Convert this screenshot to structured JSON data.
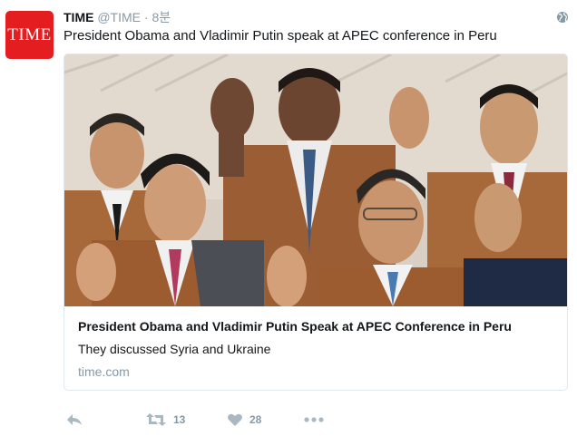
{
  "tweet": {
    "avatar_text": "TIME",
    "author_name": "TIME",
    "handle": "@TIME",
    "separator": "·",
    "timestamp": "8분",
    "text": "President Obama and Vladimir Putin speak at APEC conference in Peru",
    "audience_icon": "globe-icon"
  },
  "card": {
    "image_icon": "photo",
    "title": "President Obama and Vladimir Putin Speak at APEC Conference in Peru",
    "description": "They discussed Syria and Ukraine",
    "domain": "time.com"
  },
  "actions": {
    "reply_icon": "reply-icon",
    "retweet_icon": "retweet-icon",
    "retweet_count": "13",
    "like_icon": "heart-icon",
    "like_count": "28",
    "more_icon": "more-icon"
  },
  "colors": {
    "brand": "#e41d21",
    "muted": "#8899a6",
    "text": "#14171a",
    "border": "#e1e8ed"
  }
}
